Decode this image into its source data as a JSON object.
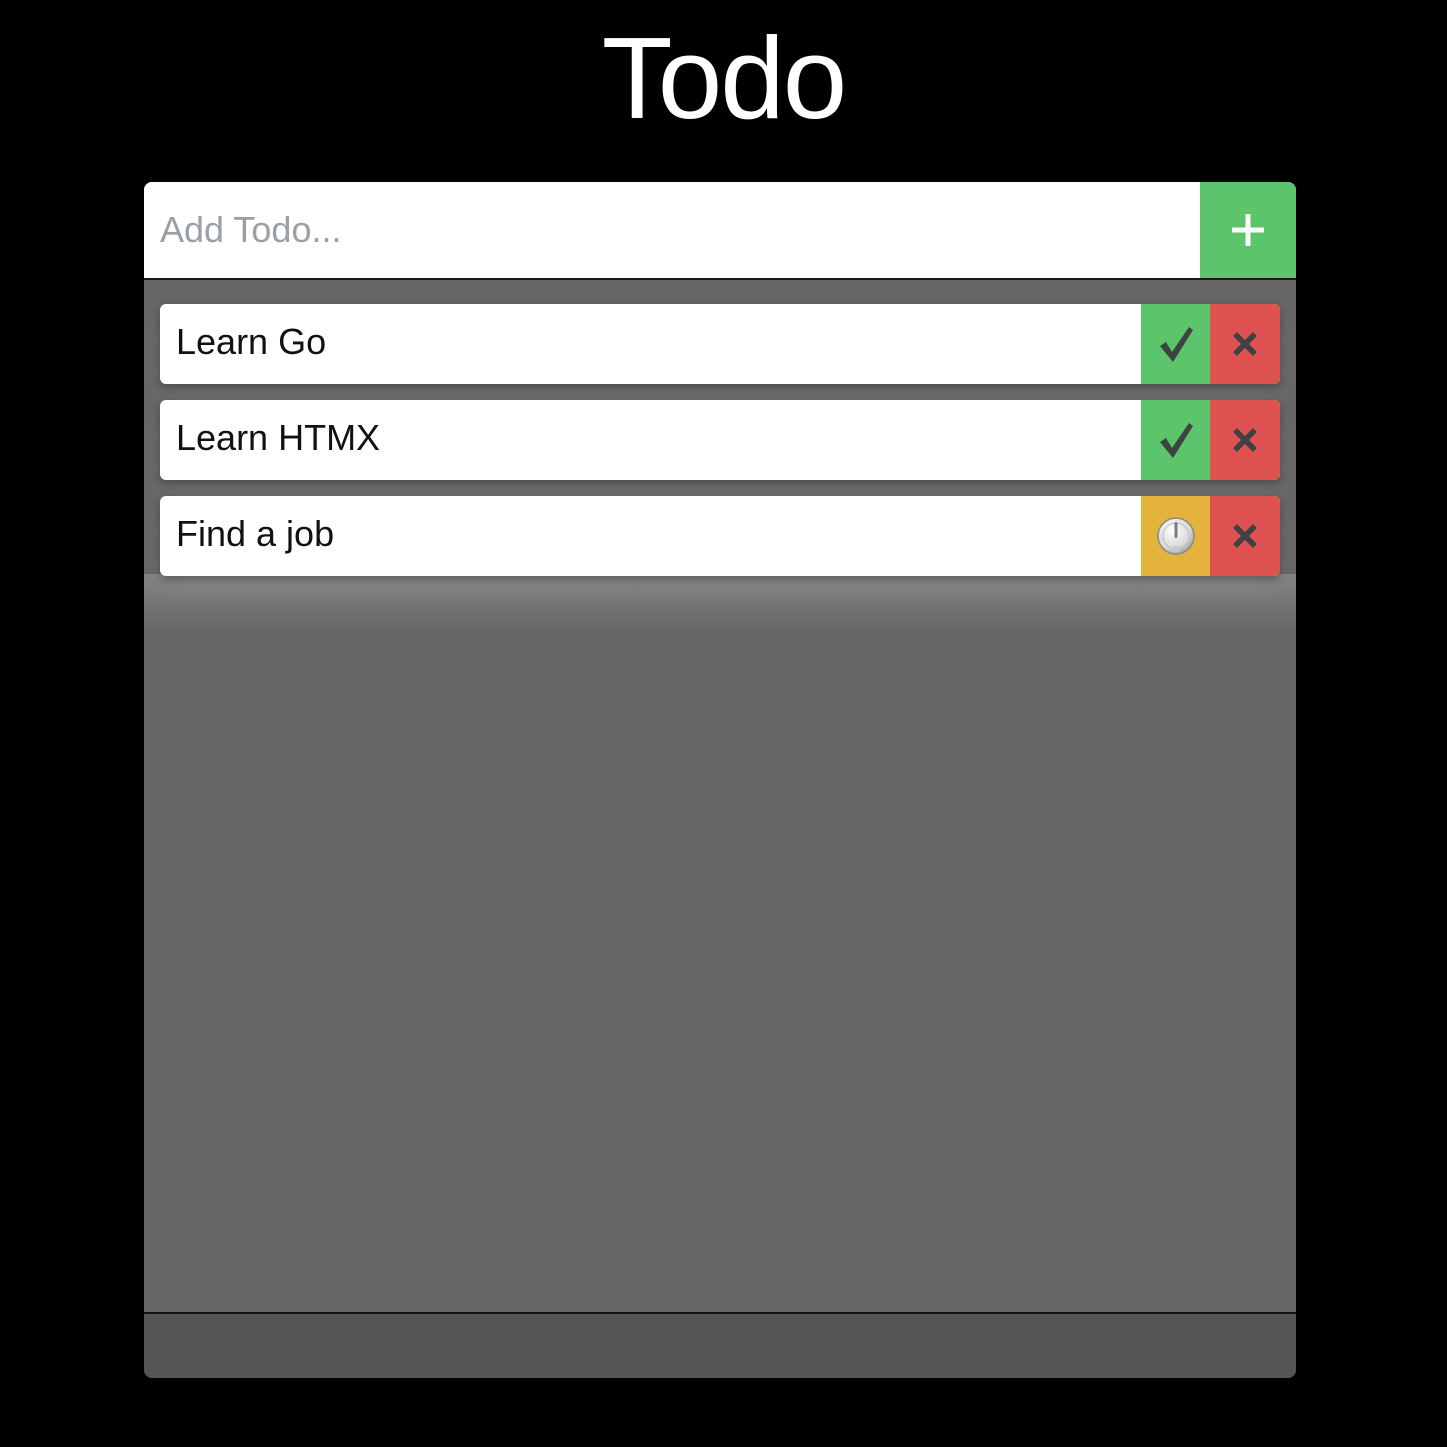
{
  "app": {
    "title": "Todo"
  },
  "add_bar": {
    "placeholder": "Add Todo...",
    "button_icon": "plus-icon"
  },
  "todos": [
    {
      "label": "Learn Go",
      "status": "done",
      "status_icon": "checkmark-icon",
      "delete_icon": "close-icon"
    },
    {
      "label": "Learn HTMX",
      "status": "done",
      "status_icon": "checkmark-icon",
      "delete_icon": "close-icon"
    },
    {
      "label": "Find a job",
      "status": "pending",
      "status_icon": "timer-icon",
      "delete_icon": "close-icon"
    }
  ],
  "colors": {
    "background": "#000000",
    "panel": "#666666",
    "footer": "#535557",
    "done": "#5cc46a",
    "pending": "#e4b33c",
    "delete": "#de5350"
  }
}
